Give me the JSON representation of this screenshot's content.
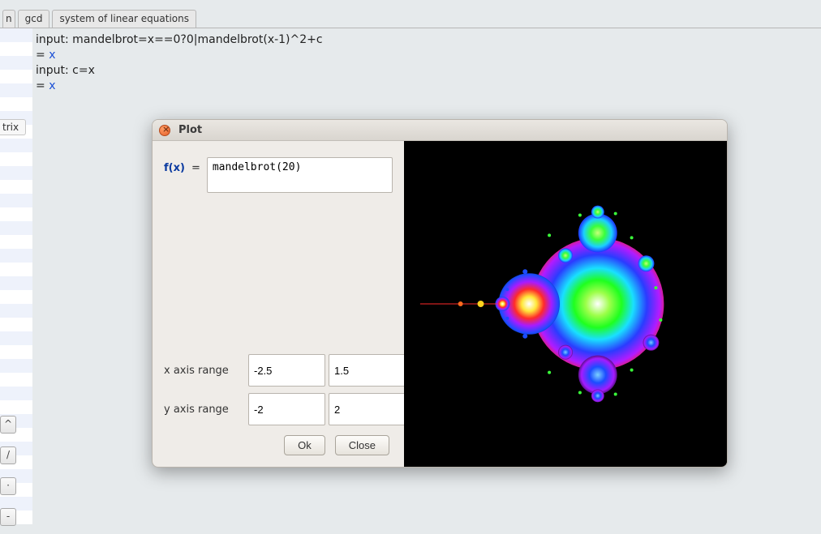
{
  "tabs": {
    "t0": "n",
    "t1": "gcd",
    "t2": "system of linear equations"
  },
  "sidebar": {
    "label_trix": "trix"
  },
  "mini_buttons": {
    "b0": "^",
    "b1": "/",
    "b2": "·",
    "b3": "-"
  },
  "console": {
    "l1": "input: mandelbrot=x==0?0|mandelbrot(x-1)^2+c",
    "l2": "= ",
    "l2_x": "x",
    "l3": "",
    "l4": "input: c=x",
    "l5": "= ",
    "l5_x": "x"
  },
  "dialog": {
    "title": "Plot",
    "fx_label": "f(x)",
    "eq": "=",
    "fx_value": "mandelbrot(20)",
    "x_range_label": "x axis range",
    "y_range_label": "y axis range",
    "x_min": "-2.5",
    "x_max": "1.5",
    "y_min": "-2",
    "y_max": "2",
    "ok_label": "Ok",
    "close_label": "Close"
  }
}
